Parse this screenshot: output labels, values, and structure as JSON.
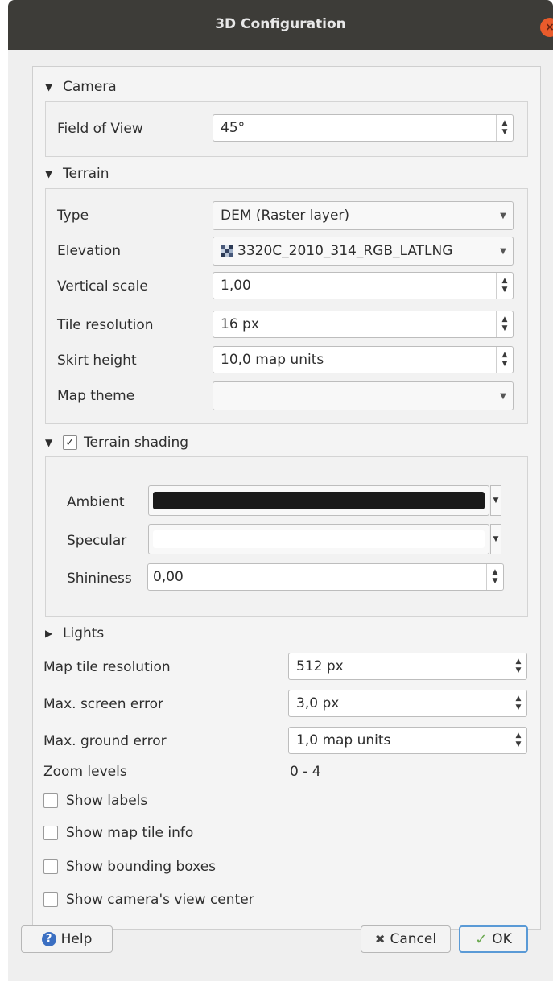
{
  "window": {
    "title": "3D Configuration",
    "close_icon": "close-icon"
  },
  "camera": {
    "header": "Camera",
    "fov_label": "Field of View",
    "fov_value": "45°"
  },
  "terrain": {
    "header": "Terrain",
    "type_label": "Type",
    "type_value": "DEM (Raster layer)",
    "elevation_label": "Elevation",
    "elevation_value": "3320C_2010_314_RGB_LATLNG",
    "vertical_scale_label": "Vertical scale",
    "vertical_scale_value": "1,00",
    "tile_resolution_label": "Tile resolution",
    "tile_resolution_value": "16 px",
    "skirt_height_label": "Skirt height",
    "skirt_height_value": "10,0 map units",
    "map_theme_label": "Map theme",
    "map_theme_value": ""
  },
  "shading": {
    "header": "Terrain shading",
    "checked": true,
    "ambient_label": "Ambient",
    "ambient_color": "#1a1a1a",
    "specular_label": "Specular",
    "specular_color": "#ffffff",
    "shininess_label": "Shininess",
    "shininess_value": "0,00"
  },
  "lights": {
    "header": "Lights"
  },
  "general": {
    "map_tile_resolution_label": "Map tile resolution",
    "map_tile_resolution_value": "512 px",
    "max_screen_error_label": "Max. screen error",
    "max_screen_error_value": "3,0 px",
    "max_ground_error_label": "Max. ground error",
    "max_ground_error_value": "1,0 map units",
    "zoom_levels_label": "Zoom levels",
    "zoom_levels_value": "0 - 4"
  },
  "options": [
    {
      "label": "Show labels",
      "checked": false
    },
    {
      "label": "Show map tile info",
      "checked": false
    },
    {
      "label": "Show bounding boxes",
      "checked": false
    },
    {
      "label": "Show camera's view center",
      "checked": false
    }
  ],
  "buttons": {
    "help": "Help",
    "cancel": "Cancel",
    "ok": "OK"
  },
  "colors": {
    "titlebar": "#3d3c38",
    "close": "#e95b2b",
    "ok_border": "#5a9ad6"
  }
}
